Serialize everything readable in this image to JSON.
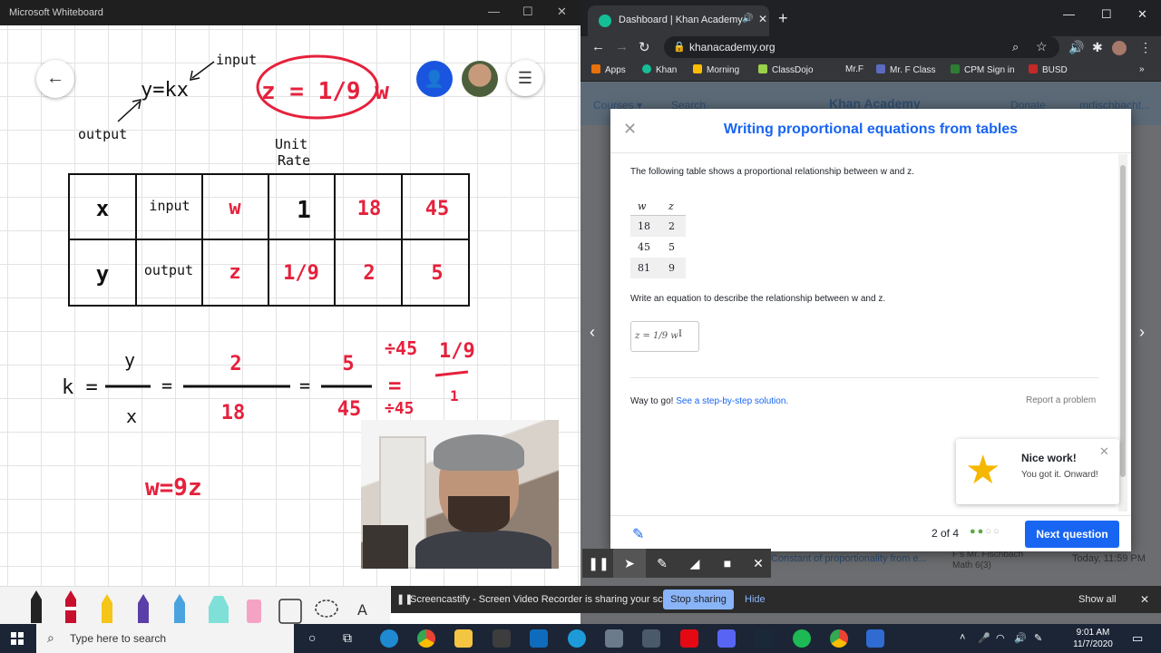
{
  "whiteboard": {
    "window_title": "Microsoft Whiteboard",
    "notes": {
      "equation_top": "y=kx",
      "input_label": "input",
      "output_label": "output",
      "circled_equation": "z = 1/9 w",
      "unit_rate_line1": "Unit",
      "unit_rate_line2": "Rate",
      "k_label": "k =",
      "frac1_num": "y",
      "frac1_den": "x",
      "frac2_num": "2",
      "frac2_den": "18",
      "frac3_num": "5",
      "frac3_den": "45",
      "div_top": "÷45",
      "div_bottom": "÷45",
      "frac4_num": "1/9",
      "frac4_den": "1",
      "answer": "w=9z"
    },
    "table": {
      "rows": [
        [
          "x",
          "input",
          "w",
          "1",
          "18",
          "45"
        ],
        [
          "y",
          "output",
          "z",
          "1/9",
          "2",
          "5"
        ]
      ]
    }
  },
  "chrome": {
    "tab_title": "Dashboard | Khan Academy",
    "url": "khanacademy.org",
    "bookmarks": [
      "Apps",
      "Khan",
      "Morning",
      "ClassDojo",
      "Mr.F",
      "Mr. F Class",
      "CPM Sign in",
      "BUSD"
    ],
    "ka_nav": {
      "courses": "Courses ▾",
      "search": "Search",
      "logo": "Khan Academy",
      "donate": "Donate",
      "user": "mrfischbacht..."
    },
    "bg_rows": {
      "assignment": "Constant of proportionality from e...",
      "class_name": "F's Mr. Fischbach Math 6(3)",
      "time": "Today, 11:59 PM"
    }
  },
  "exercise": {
    "title": "Writing proportional equations from tables",
    "intro": "The following table shows a proportional relationship between w and z.",
    "columns": [
      "w",
      "z"
    ],
    "rows": [
      [
        "18",
        "2"
      ],
      [
        "45",
        "5"
      ],
      [
        "81",
        "9"
      ]
    ],
    "question": "Write an equation to describe the relationship between w and z.",
    "answer_value": "z = 1/9 w",
    "feedback": "Way to go!",
    "solution_link": "See a step-by-step solution.",
    "report": "Report a problem",
    "toast_title": "Nice work!",
    "toast_sub": "You got it. Onward!",
    "progress": "2 of 4",
    "next_button": "Next question"
  },
  "screencastify": {
    "message": "Screencastify - Screen Video Recorder is sharing your screen.",
    "stop": "Stop sharing",
    "hide": "Hide",
    "show_all": "Show all"
  },
  "taskbar": {
    "search_placeholder": "Type here to search",
    "time": "9:01 AM",
    "date": "11/7/2020"
  },
  "colors": {
    "ka_blue": "#1865f2",
    "ink_red": "#e5213c",
    "taskbar": "#1b2536"
  }
}
